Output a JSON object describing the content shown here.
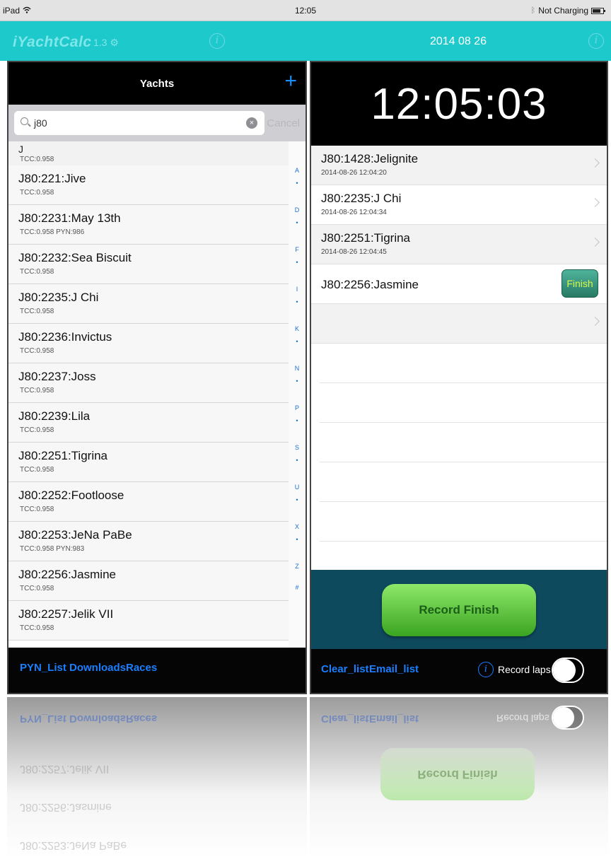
{
  "status_bar": {
    "device": "iPad",
    "time": "12:05",
    "battery": "Not Charging"
  },
  "nav": {
    "app_title": "iYachtCalc",
    "version": "1.3",
    "info_glyph": "i",
    "date": "2014 08 26"
  },
  "left": {
    "title": "Yachts",
    "add_glyph": "+",
    "search": {
      "value": "j80",
      "cancel": "Cancel",
      "clear_glyph": "×"
    },
    "section": {
      "letter": "J",
      "sub": "TCC:0.958"
    },
    "yachts": [
      {
        "name": "J80:221:Jive",
        "sub": "TCC:0.958"
      },
      {
        "name": "J80:2231:May 13th",
        "sub": "TCC:0.958 PYN:986"
      },
      {
        "name": "J80:2232:Sea Biscuit",
        "sub": "TCC:0.958"
      },
      {
        "name": "J80:2235:J Chi",
        "sub": "TCC:0.958"
      },
      {
        "name": "J80:2236:Invictus",
        "sub": "TCC:0.958"
      },
      {
        "name": "J80:2237:Joss",
        "sub": "TCC:0.958"
      },
      {
        "name": "J80:2239:Lila",
        "sub": "TCC:0.958"
      },
      {
        "name": "J80:2251:Tigrina",
        "sub": "TCC:0.958"
      },
      {
        "name": "J80:2252:Footloose",
        "sub": "TCC:0.958"
      },
      {
        "name": "J80:2253:JeNa PaBe",
        "sub": "TCC:0.958 PYN:983"
      },
      {
        "name": "J80:2256:Jasmine",
        "sub": "TCC:0.958"
      },
      {
        "name": "J80:2257:Jelik VII",
        "sub": "TCC:0.958"
      }
    ],
    "index": [
      "A",
      "•",
      "D",
      "•",
      "F",
      "•",
      "I",
      "•",
      "K",
      "•",
      "N",
      "•",
      "P",
      "•",
      "S",
      "•",
      "U",
      "•",
      "X",
      "•",
      "Z",
      "#"
    ],
    "toolbar": {
      "pyn_list": "PYN_List",
      "downloads": "Downloads",
      "races": "Races"
    }
  },
  "right": {
    "clock": "12:05:03",
    "finishes": [
      {
        "name": "J80:1428:Jelignite",
        "timestamp": "2014-08-26 12:04:20"
      },
      {
        "name": "J80:2235:J Chi",
        "timestamp": "2014-08-26 12:04:34"
      },
      {
        "name": "J80:2251:Tigrina",
        "timestamp": "2014-08-26 12:04:45"
      }
    ],
    "pending": {
      "name": "J80:2256:Jasmine",
      "finish_label": "Finish"
    },
    "record_finish": "Record Finish",
    "toolbar": {
      "clear_list": "Clear_list",
      "email_list": "Email_list",
      "info_glyph": "i",
      "record_laps": "Record laps",
      "record_laps_on": true
    }
  },
  "colors": {
    "nav_teal": "#1ec9cb",
    "record_green": "#5cc93a",
    "record_area": "#0e4a5e",
    "link_blue": "#1a7fff",
    "finish_text": "#d9f84a"
  }
}
